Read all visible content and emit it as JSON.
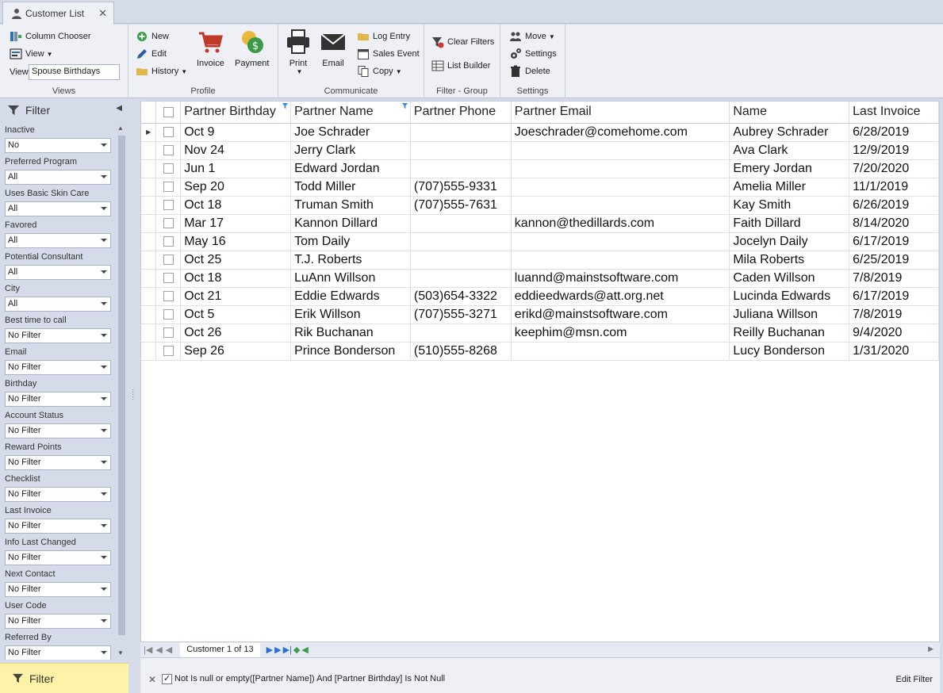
{
  "tab": {
    "title": "Customer List",
    "close": "✕"
  },
  "ribbon": {
    "views": {
      "label": "Views",
      "column_chooser": "Column Chooser",
      "view_menu": "View",
      "view_field_label": "View",
      "view_field_value": "Spouse Birthdays"
    },
    "profile": {
      "label": "Profile",
      "new": "New",
      "edit": "Edit",
      "history": "History",
      "invoice": "Invoice",
      "payment": "Payment"
    },
    "communicate": {
      "label": "Communicate",
      "print": "Print",
      "email": "Email",
      "log_entry": "Log Entry",
      "sales_event": "Sales Event",
      "copy": "Copy"
    },
    "filter_group": {
      "label": "Filter - Group",
      "clear_filters": "Clear Filters",
      "list_builder": "List Builder"
    },
    "settings": {
      "label": "Settings",
      "move": "Move",
      "settings": "Settings",
      "delete": "Delete"
    }
  },
  "filter_panel": {
    "title": "Filter",
    "footer": "Filter",
    "items": [
      {
        "label": "Inactive",
        "value": "No"
      },
      {
        "label": "Preferred Program",
        "value": "All"
      },
      {
        "label": "Uses Basic Skin Care",
        "value": "All"
      },
      {
        "label": "Favored",
        "value": "All"
      },
      {
        "label": "Potential Consultant",
        "value": "All"
      },
      {
        "label": "City",
        "value": "All"
      },
      {
        "label": "Best time to call",
        "value": "No Filter"
      },
      {
        "label": "Email",
        "value": "No Filter"
      },
      {
        "label": "Birthday",
        "value": "No Filter"
      },
      {
        "label": "Account Status",
        "value": "No Filter"
      },
      {
        "label": "Reward Points",
        "value": "No Filter"
      },
      {
        "label": "Checklist",
        "value": "No Filter"
      },
      {
        "label": "Last Invoice",
        "value": "No Filter"
      },
      {
        "label": "Info Last Changed",
        "value": "No Filter"
      },
      {
        "label": "Next Contact",
        "value": "No Filter"
      },
      {
        "label": "User Code",
        "value": "No Filter"
      },
      {
        "label": "Referred By",
        "value": "No Filter"
      }
    ]
  },
  "grid": {
    "columns": [
      "Partner Birthday",
      "Partner Name",
      "Partner Phone",
      "Partner Email",
      "Name",
      "Last Invoice"
    ],
    "rows": [
      [
        "Oct 9",
        "Joe Schrader",
        "",
        "Joeschrader@comehome.com",
        "Aubrey Schrader",
        "6/28/2019"
      ],
      [
        "Nov 24",
        "Jerry Clark",
        "",
        "",
        "Ava Clark",
        "12/9/2019"
      ],
      [
        "Jun 1",
        "Edward Jordan",
        "",
        "",
        "Emery Jordan",
        "7/20/2020"
      ],
      [
        "Sep 20",
        "Todd Miller",
        "(707)555-9331",
        "",
        "Amelia Miller",
        "11/1/2019"
      ],
      [
        "Oct 18",
        "Truman Smith",
        "(707)555-7631",
        "",
        "Kay Smith",
        "6/26/2019"
      ],
      [
        "Mar 17",
        "Kannon Dillard",
        "",
        "kannon@thedillards.com",
        "Faith Dillard",
        "8/14/2020"
      ],
      [
        "May 16",
        "Tom Daily",
        "",
        "",
        "Jocelyn Daily",
        "6/17/2019"
      ],
      [
        "Oct 25",
        "T.J. Roberts",
        "",
        "",
        "Mila Roberts",
        "6/25/2019"
      ],
      [
        "Oct 18",
        "LuAnn Willson",
        "",
        "luannd@mainstsoftware.com",
        "Caden Willson",
        "7/8/2019"
      ],
      [
        "Oct 21",
        "Eddie Edwards",
        "(503)654-3322",
        "eddieedwards@att.org.net",
        "Lucinda Edwards",
        "6/17/2019"
      ],
      [
        "Oct 5",
        "Erik Willson",
        "(707)555-3271",
        "erikd@mainstsoftware.com",
        "Juliana Willson",
        "7/8/2019"
      ],
      [
        "Oct 26",
        "Rik Buchanan",
        "",
        "keephim@msn.com",
        "Reilly Buchanan",
        "9/4/2020"
      ],
      [
        "Sep 26",
        "Prince Bonderson",
        "(510)555-8268",
        "",
        "Lucy Bonderson",
        "1/31/2020"
      ]
    ]
  },
  "navigator": {
    "record_text": "Customer 1 of 13"
  },
  "filter_bar": {
    "expression": "Not Is null or empty([Partner Name]) And [Partner Birthday] Is Not Null",
    "edit_filter": "Edit Filter",
    "checked_mark": "✓"
  }
}
